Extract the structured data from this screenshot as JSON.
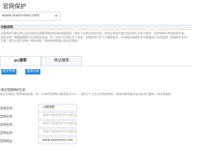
{
  "page": {
    "title": "官网保护"
  },
  "site_selector": {
    "value": "www.xiaomseo.com"
  },
  "section": {
    "title": "功能说明",
    "lines": [
      "官网保护功能可防止因仿冒或恶意篡改影响官网的搜索展现，请在下方提交相关信息，提交后将由百度对官网进行识别与保护，保护结果以审核结果为准。",
      "相关说明：需要确保提交信息真实有效，同一主体可以提交多个网站，若需修改可在下方重新提交，如有疑问请联系平台客服进行咨询处理，感谢您的支持。",
      "注意：提交信息后将进入审核流程，审核结果将通过站内信通知。"
    ]
  },
  "tabs": [
    {
      "label": "pc搜索",
      "active": true
    },
    {
      "label": "移动搜索",
      "active": false
    }
  ],
  "actions": {
    "submit_label": "提交申请",
    "records_label": "查询记录"
  },
  "form_notes": {
    "heading": "填写官网保护信息：",
    "body": "提交后请耐心等待审核结果，同一主体的官网每日最多提交1次，一般在3个工作日内完成审核，审核结果将通过站内信进行通知，请注意查收。"
  },
  "form_fields": [
    {
      "label": "官网名称：",
      "value": "小狼博客",
      "placeholder": false
    },
    {
      "label": "官网名称：",
      "value": "请填写需要保护的关键词",
      "placeholder": true
    },
    {
      "label": "官网名称：",
      "value": "请填写需要保护的关键词",
      "placeholder": true
    },
    {
      "label": "官网名称：",
      "value": "请填写需要保护的关键词",
      "placeholder": true
    },
    {
      "label": "官网网址：",
      "value": "www.xiaomseo.com",
      "placeholder": false
    }
  ],
  "colors": {
    "accent": "#2e87d4",
    "border": "#dcdfe6",
    "section_bg": "#f0f2f5"
  }
}
